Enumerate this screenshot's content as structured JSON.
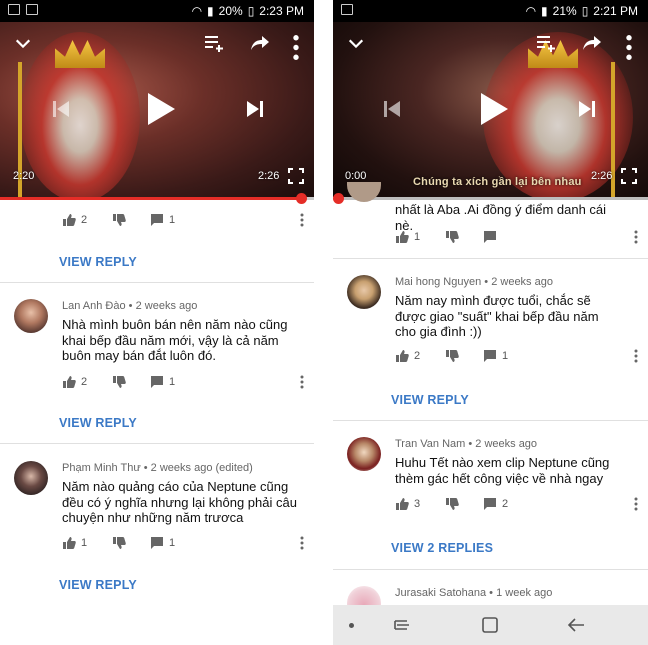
{
  "left": {
    "status": {
      "battery": "20%",
      "time": "2:23 PM"
    },
    "player": {
      "current_time": "2:20",
      "duration": "2:26",
      "progress": 0.96
    },
    "top_comment_actions": {
      "likes": "2",
      "replies": "1",
      "view_reply": "VIEW REPLY"
    },
    "comments": [
      {
        "author": "Lan Anh Đào",
        "meta": "2 weeks ago",
        "text": "Nhà mình buôn bán nên năm nào cũng khai bếp đầu năm mới, vậy là cả năm buôn may bán đắt luôn đó.",
        "likes": "2",
        "replies": "1",
        "view_reply": "VIEW REPLY"
      },
      {
        "author": "Phạm Minh Thư",
        "meta": "2 weeks ago (edited)",
        "text": "Năm nào quảng cáo của Neptune cũng đều có ý nghĩa nhưng lại không phải câu chuyện như những năm trươca",
        "likes": "1",
        "replies": "1",
        "view_reply": "VIEW REPLY"
      }
    ]
  },
  "right": {
    "status": {
      "battery": "21%",
      "time": "2:21 PM"
    },
    "player": {
      "current_time": "0:00",
      "duration": "2:26",
      "progress": 0.0,
      "subtitle": "Chúng ta xích gần lại bên nhau"
    },
    "partial_comment": {
      "text": "nhất là Aba .Ai đồng ý điểm danh cái nè.",
      "likes": "1"
    },
    "comments": [
      {
        "author": "Mai hong Nguyen",
        "meta": "2 weeks ago",
        "text": "Năm nay mình được tuổi, chắc sẽ được giao \"suất\" khai bếp đầu năm cho gia đình :))",
        "likes": "2",
        "replies": "1",
        "view_reply": "VIEW REPLY"
      },
      {
        "author": "Tran Van Nam",
        "meta": "2 weeks ago",
        "text": "Huhu Tết nào xem clip Neptune cũng thèm gác hết công việc về nhà ngay",
        "likes": "3",
        "replies": "2",
        "view_reply": "VIEW 2 REPLIES"
      },
      {
        "author": "Jurasaki Satohana",
        "meta": "1 week ago"
      }
    ]
  },
  "colors": {
    "accent_blue": "#3b79c6",
    "progress_red": "#e52d27"
  }
}
